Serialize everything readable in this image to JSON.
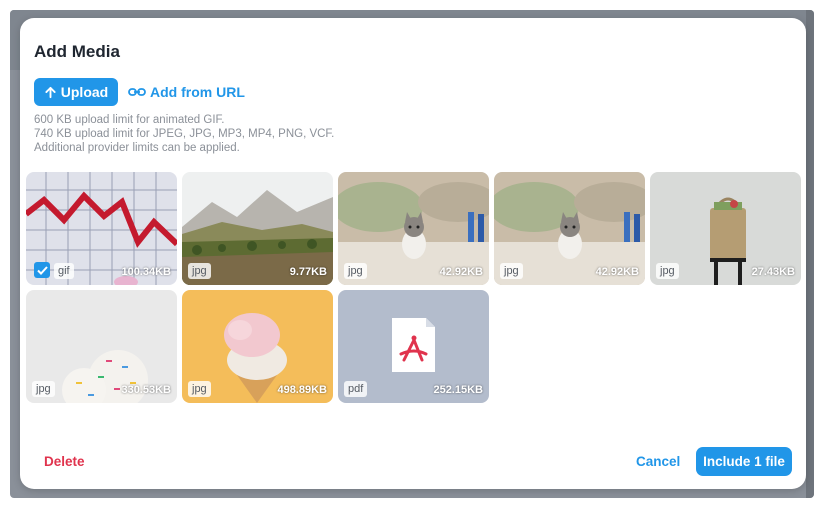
{
  "dialog": {
    "title": "Add Media",
    "upload_label": "Upload",
    "add_url_label": "Add from URL",
    "limits": [
      "600 KB upload limit for animated GIF.",
      "740 KB upload limit for JPEG, JPG, MP3, MP4, PNG, VCF.",
      "Additional provider limits can be applied."
    ]
  },
  "media": [
    {
      "ext": "gif",
      "size": "100.34KB",
      "selected": true,
      "icon": "chart-image"
    },
    {
      "ext": "jpg",
      "size": "9.77KB",
      "selected": false,
      "icon": "landscape-image"
    },
    {
      "ext": "jpg",
      "size": "42.92KB",
      "selected": false,
      "icon": "kitten-image"
    },
    {
      "ext": "jpg",
      "size": "42.92KB",
      "selected": false,
      "icon": "kitten-image"
    },
    {
      "ext": "jpg",
      "size": "27.43KB",
      "selected": false,
      "icon": "bag-image"
    },
    {
      "ext": "jpg",
      "size": "330.53KB",
      "selected": false,
      "icon": "donuts-image"
    },
    {
      "ext": "jpg",
      "size": "498.89KB",
      "selected": false,
      "icon": "icecream-image"
    },
    {
      "ext": "pdf",
      "size": "252.15KB",
      "selected": false,
      "icon": "pdf-icon"
    }
  ],
  "footer": {
    "delete_label": "Delete",
    "cancel_label": "Cancel",
    "include_label": "Include 1 file"
  },
  "colors": {
    "accent": "#2196e8",
    "danger": "#e0334d"
  }
}
